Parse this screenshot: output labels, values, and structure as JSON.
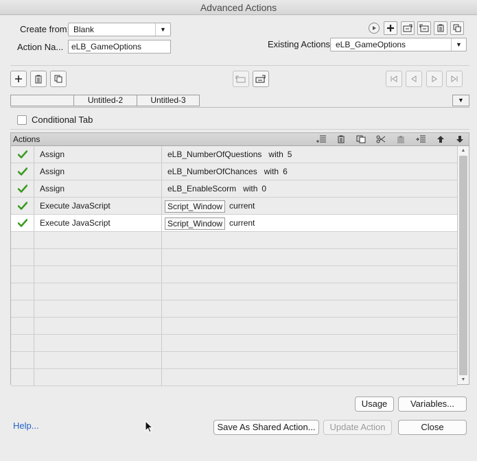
{
  "window": {
    "title": "Advanced Actions"
  },
  "form": {
    "create_from_label": "Create from:",
    "create_from_value": "Blank",
    "action_name_label": "Action Na...",
    "action_name_value": "eLB_GameOptions",
    "existing_actions_label": "Existing Actions:",
    "existing_actions_value": "eLB_GameOptions"
  },
  "tabs": [
    "",
    "Untitled-2",
    "Untitled-3"
  ],
  "conditional_tab_label": "Conditional Tab",
  "conditional_tab_checked": false,
  "table": {
    "header": "Actions",
    "rows": [
      {
        "status": "check",
        "action": "Assign",
        "target": "eLB_NumberOfQuestions",
        "keyword": "with",
        "value": "5"
      },
      {
        "status": "check",
        "action": "Assign",
        "target": "eLB_NumberOfChances",
        "keyword": "with",
        "value": "6"
      },
      {
        "status": "check",
        "action": "Assign",
        "target": "eLB_EnableScorm",
        "keyword": "with",
        "value": "0"
      },
      {
        "status": "check",
        "action": "Execute JavaScript",
        "button": "Script_Window",
        "value": "current"
      },
      {
        "status": "check",
        "action": "Execute JavaScript",
        "button": "Script_Window",
        "value": "current",
        "selected": true
      }
    ],
    "empty_rows": 9
  },
  "buttons": {
    "usage": "Usage",
    "variables": "Variables...",
    "help": "Help...",
    "save_shared": "Save As Shared Action...",
    "update_action": "Update Action",
    "close": "Close"
  },
  "colors": {
    "check_green": "#3c9a1e",
    "link_blue": "#2463c8"
  }
}
